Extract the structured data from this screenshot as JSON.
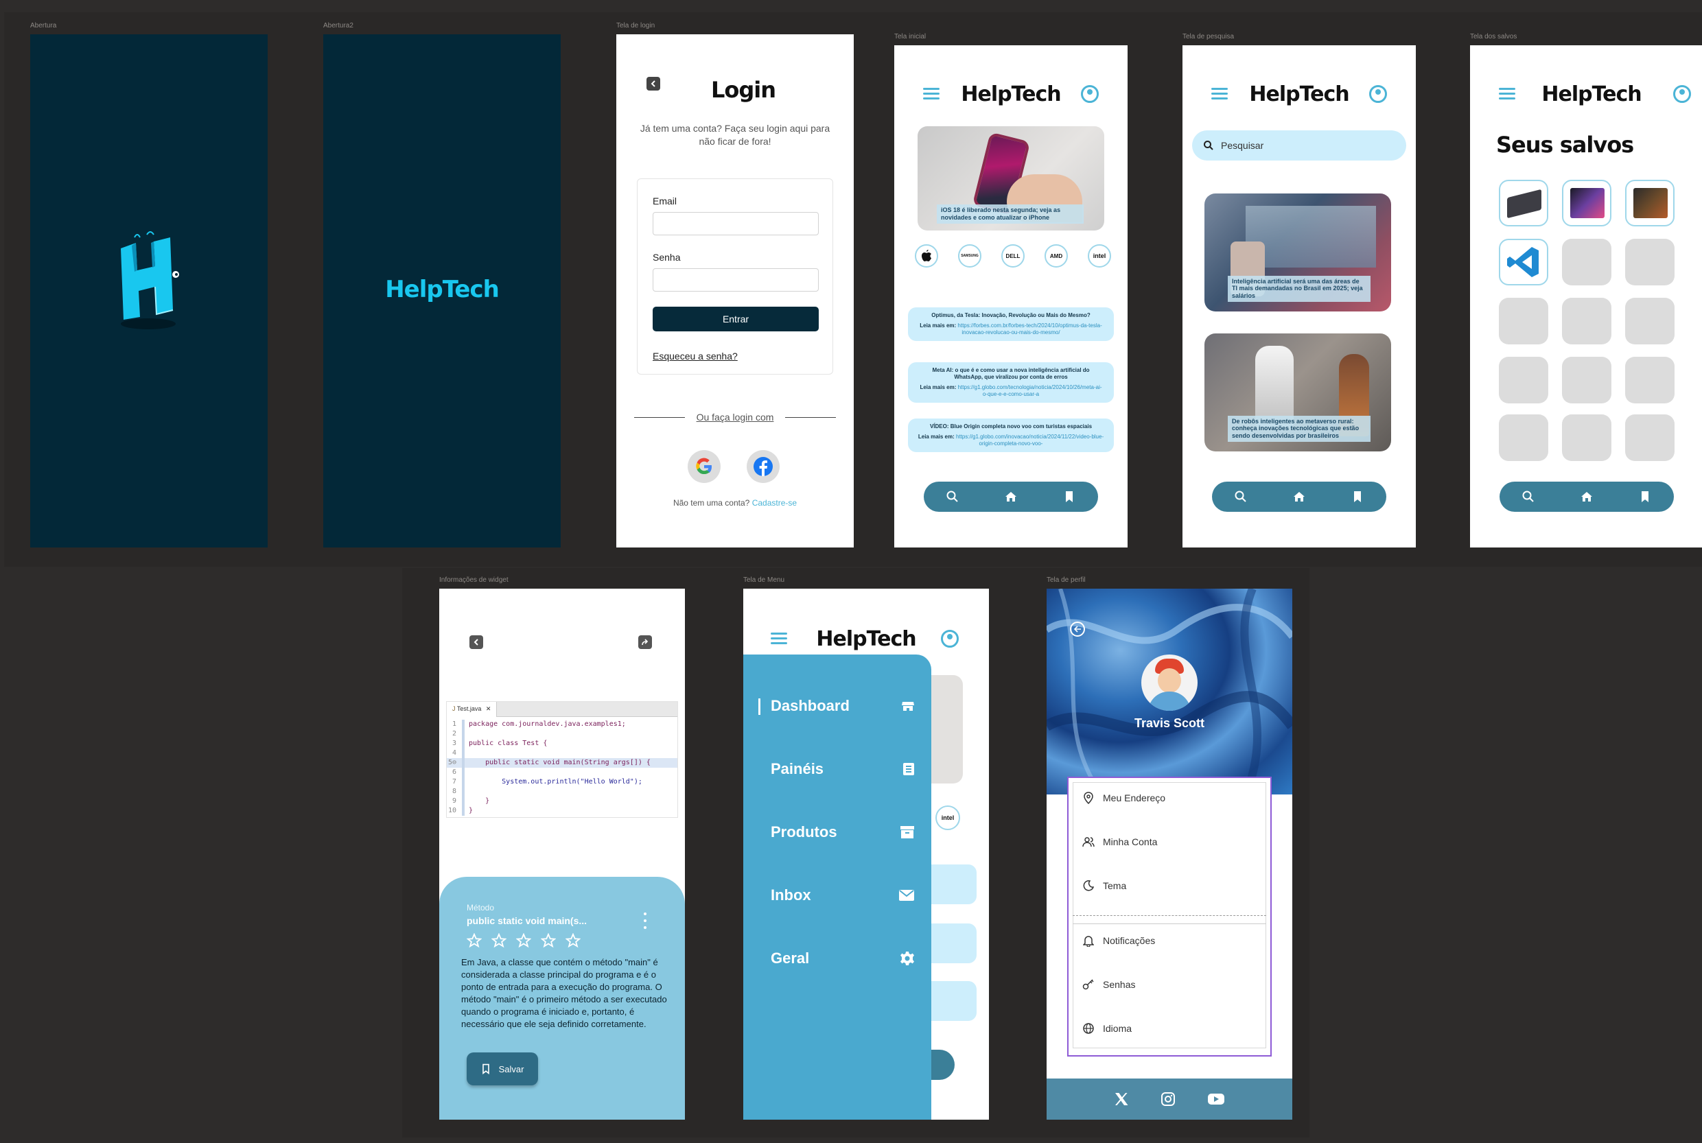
{
  "frames": {
    "abertura": "Abertura",
    "abertura2": "Abertura2",
    "login": "Tela de login",
    "inicial": "Tela inicial",
    "pesquisa": "Tela de pesquisa",
    "salvos": "Tela dos salvos",
    "widget": "Informações de widget",
    "menu": "Tela de Menu",
    "perfil": "Tela de perfil"
  },
  "brand": "HelpTech",
  "login": {
    "title": "Login",
    "subtitle": "Já tem uma conta? Faça seu login aqui para não ficar de fora!",
    "email_label": "Email",
    "senha_label": "Senha",
    "submit": "Entrar",
    "forgot": "Esqueceu a senha?",
    "or_login": "Ou faça login com",
    "no_account": "Não tem uma conta?",
    "signup": "Cadastre-se"
  },
  "home": {
    "hero_caption": "iOS 18 é liberado nesta segunda; veja as novidades e como atualizar o iPhone",
    "brands": [
      "Apple",
      "SAMSUNG",
      "DELL",
      "AMD",
      "intel"
    ],
    "news": [
      {
        "title": "Optimus, da Tesla: Inovação, Revolução ou Mais do Mesmo?",
        "prefix": "Leia mais em:",
        "link": "https://forbes.com.br/forbes-tech/2024/10/optimus-da-tesla-inovacao-revolucao-ou-mais-do-mesmo/"
      },
      {
        "title": "Meta AI: o que é e como usar a nova inteligência artificial do WhatsApp, que viralizou por conta de erros",
        "prefix": "Leia mais em:",
        "link": "https://g1.globo.com/tecnologia/noticia/2024/10/26/meta-ai-o-que-e-e-como-usar-a"
      },
      {
        "title": "VÍDEO: Blue Origin completa novo voo com turistas espaciais",
        "prefix": "Leia mais em:",
        "link": "https://g1.globo.com/inovacao/noticia/2024/11/22/video-blue-origin-completa-novo-voo-"
      }
    ]
  },
  "search": {
    "placeholder": "Pesquisar",
    "cards": [
      "Inteligência artificial será uma das áreas de TI mais demandadas no Brasil em 2025; veja salários",
      "De robôs inteligentes ao metaverso rural: conheça inovações tecnológicas que estão sendo desenvolvidas por brasileiros"
    ]
  },
  "saved": {
    "title": "Seus salvos"
  },
  "widget": {
    "tab": "Test.java",
    "code_lines": [
      {
        "n": "1",
        "t": "package com.journaldev.java.examples1;"
      },
      {
        "n": "2",
        "t": ""
      },
      {
        "n": "3",
        "t": "public class Test {"
      },
      {
        "n": "4",
        "t": ""
      },
      {
        "n": "5⊖",
        "t": "    public static void main(String args[]) {"
      },
      {
        "n": "6",
        "t": ""
      },
      {
        "n": "7",
        "t": "        System.out.println(\"Hello World\");"
      },
      {
        "n": "8",
        "t": ""
      },
      {
        "n": "9",
        "t": "    }"
      },
      {
        "n": "10",
        "t": "}"
      }
    ],
    "label": "Método",
    "method": "public static void main(s...",
    "rating": 0,
    "description": "Em Java, a classe que contém o método \"main\" é considerada a classe principal do programa e é o ponto de entrada para a execução do programa. O método \"main\" é o primeiro método a ser executado quando o programa é iniciado e, portanto, é necessário que ele seja definido corretamente.",
    "save": "Salvar"
  },
  "menu": {
    "items": [
      "Dashboard",
      "Painéis",
      "Produtos",
      "Inbox",
      "Geral"
    ]
  },
  "profile": {
    "name": "Travis Scott",
    "items": [
      "Meu Endereço",
      "Minha Conta",
      "Tema",
      "Notificações",
      "Senhas",
      "Idioma"
    ],
    "social": [
      "x-icon",
      "instagram-icon",
      "youtube-icon"
    ]
  },
  "colors": {
    "dark": "#032838",
    "accent": "#4bb4d6",
    "nav": "#3b7f98",
    "login_btn": "#062a3a"
  }
}
